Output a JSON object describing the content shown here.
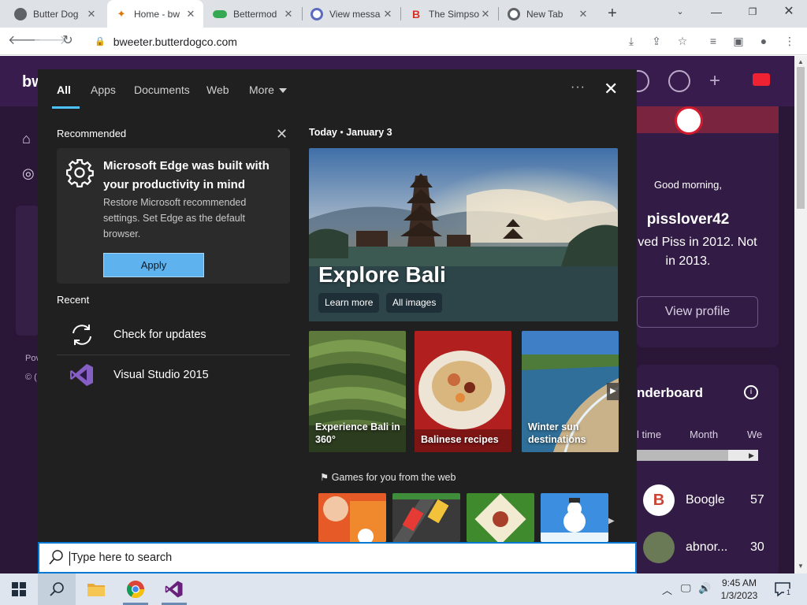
{
  "browser": {
    "tabs": [
      {
        "title": "Butter Dog",
        "color": "#5f6368"
      },
      {
        "title": "Home - bw",
        "color": "#e37400"
      },
      {
        "title": "Bettermod",
        "color": "#34a853"
      },
      {
        "title": "View messa",
        "color": "#5c6bc0"
      },
      {
        "title": "The Simpso",
        "color": "#d93025"
      },
      {
        "title": "New Tab",
        "color": "#5f6368"
      }
    ],
    "url": "bweeter.butterdogco.com"
  },
  "page": {
    "logo": "bw",
    "left_text_1": "Pov",
    "left_text_2": "© (",
    "greeting": "Good morning,",
    "username": "pisslover42",
    "bio_line1": "ved Piss in 2012. Not",
    "bio_line2": "in 2013.",
    "view_profile": "View profile",
    "leaderboard_title": "nderboard",
    "filters": [
      "l time",
      "Month",
      "We"
    ],
    "leaders": [
      {
        "name": "Boogle",
        "score": "57"
      },
      {
        "name": "abnor...",
        "score": "30"
      }
    ]
  },
  "search": {
    "tabs": {
      "all": "All",
      "apps": "Apps",
      "documents": "Documents",
      "web": "Web",
      "more": "More"
    },
    "recommended_title": "Recommended",
    "rec_card": {
      "title": "Microsoft Edge was built with your productivity in mind",
      "description": "Restore Microsoft recommended settings. Set Edge as the default browser.",
      "button": "Apply"
    },
    "recent_title": "Recent",
    "recent": [
      {
        "label": "Check for updates",
        "icon": "refresh-icon"
      },
      {
        "label": "Visual Studio 2015",
        "icon": "visual-studio-icon"
      }
    ],
    "today_label": "Today",
    "today_date": "January 3",
    "hero": {
      "title": "Explore Bali",
      "btn1": "Learn more",
      "btn2": "All images"
    },
    "tiles": [
      {
        "label": "Experience Bali in 360°"
      },
      {
        "label": "Balinese recipes"
      },
      {
        "label": "Winter sun destinations"
      }
    ],
    "games_title": "Games for you from the web",
    "placeholder": "Type here to search"
  },
  "taskbar": {
    "time": "9:45 AM",
    "date": "1/3/2023",
    "notification_count": "1"
  }
}
